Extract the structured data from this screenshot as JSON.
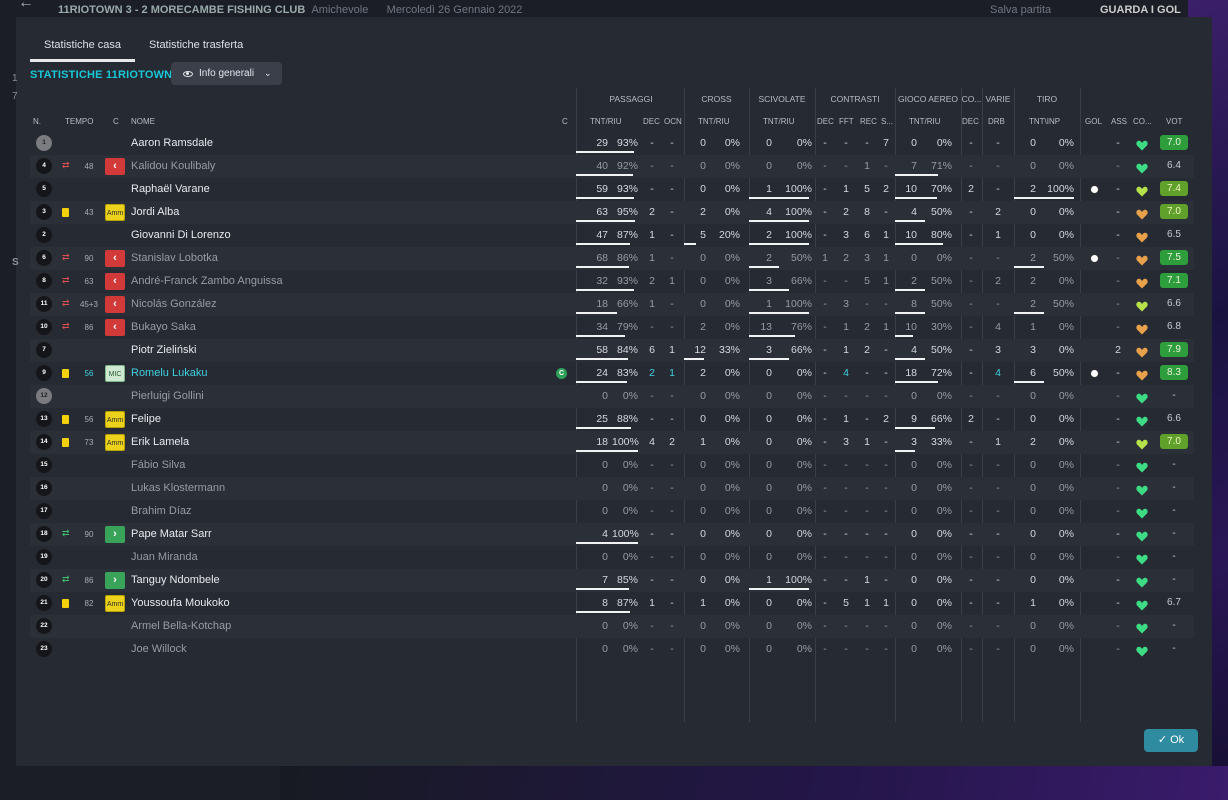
{
  "topbar": {
    "back": "←",
    "match": "11RIOTOWN 3 - 2 MORECAMBE FISHING CLUB",
    "type": "Amichevole",
    "date": "Mercoledì 26 Gennaio 2022",
    "save": "Salva partita",
    "goals": "GUARDA I GOL"
  },
  "tabs": [
    "Statistiche casa",
    "Statistiche trasferta"
  ],
  "team_title": "STATISTICHE 11RIOTOWN",
  "dropdown": "Info generali",
  "groups": {
    "passaggi": "PASSAGGI",
    "cross": "CROSS",
    "scivolate": "SCIVOLATE",
    "contrasti": "CONTRASTI",
    "aereo": "GIOCO AEREO",
    "co": "CO...",
    "varie": "VARIE",
    "tiro": "TIRO"
  },
  "headers": {
    "n": "N.",
    "tempo": "TEMPO",
    "c": "C",
    "nome": "NOME",
    "c2": "C",
    "p": "TNT/RIU",
    "dec": "DEC",
    "ocn": "OCN",
    "cr": "TNT/RIU",
    "sc": "TNT/RIU",
    "cdec": "DEC",
    "fft": "FFT",
    "rec": "REC",
    "s": "S...",
    "ga": "TNT/RIU",
    "codec": "DEC",
    "drb": "DRB",
    "tiro": "TNT\\INP",
    "gol": "GOL",
    "ass": "ASS",
    "co": "CO...",
    "vot": "VOT"
  },
  "colors": {
    "accent": "#18c8d8",
    "button": "#2e8ba0",
    "vote_good": "#2e9d3c"
  },
  "ok_label": "Ok",
  "players": [
    {
      "n": "1",
      "gk": true,
      "name": "Aaron Ramsdale",
      "dim": false,
      "p": [
        "29",
        "93%"
      ],
      "pb": 0.93,
      "pdec": "-",
      "ocn": "-",
      "cr": [
        "0",
        "0%"
      ],
      "crb": 0,
      "sc": [
        "0",
        "0%"
      ],
      "scb": 0,
      "cdec": "-",
      "fft": "-",
      "rec": "-",
      "s": "7",
      "ga": [
        "0",
        "0%"
      ],
      "gab": 0,
      "codec": "-",
      "drb": "-",
      "tiro": [
        "0",
        "0%"
      ],
      "tb": 0,
      "gol": "",
      "ass": "-",
      "heart": "green",
      "vot": "7.0",
      "votc": "good"
    },
    {
      "n": "4",
      "sub": "off",
      "min": "48",
      "cbox": "red",
      "name": "Kalidou Koulibaly",
      "dim": true,
      "p": [
        "40",
        "92%"
      ],
      "pb": 0.92,
      "pdec": "-",
      "ocn": "-",
      "cr": [
        "0",
        "0%"
      ],
      "crb": 0,
      "sc": [
        "0",
        "0%"
      ],
      "scb": 0,
      "cdec": "-",
      "fft": "-",
      "rec": "1",
      "s": "-",
      "ga": [
        "7",
        "71%"
      ],
      "gab": 0.71,
      "codec": "-",
      "drb": "-",
      "tiro": [
        "0",
        "0%"
      ],
      "tb": 0,
      "gol": "",
      "ass": "-",
      "heart": "green",
      "vot": "6.4",
      "votc": ""
    },
    {
      "n": "5",
      "name": "Raphaël Varane",
      "dim": false,
      "p": [
        "59",
        "93%"
      ],
      "pb": 0.93,
      "pdec": "-",
      "ocn": "-",
      "cr": [
        "0",
        "0%"
      ],
      "crb": 0,
      "sc": [
        "1",
        "100%"
      ],
      "scb": 1,
      "cdec": "-",
      "fft": "1",
      "rec": "5",
      "s": "2",
      "ga": [
        "10",
        "70%"
      ],
      "gab": 0.7,
      "codec": "2",
      "drb": "-",
      "tiro": [
        "2",
        "100%"
      ],
      "tb": 1,
      "gol": "ball",
      "ass": "-",
      "heart": "lime",
      "vot": "7.4",
      "votc": "ok"
    },
    {
      "n": "3",
      "yellow": true,
      "min": "43",
      "cbox": "amm",
      "name": "Jordi Alba",
      "dim": false,
      "p": [
        "63",
        "95%"
      ],
      "pb": 0.95,
      "pdec": "2",
      "ocn": "-",
      "cr": [
        "2",
        "0%"
      ],
      "crb": 0,
      "sc": [
        "4",
        "100%"
      ],
      "scb": 1,
      "cdec": "-",
      "fft": "2",
      "rec": "8",
      "s": "-",
      "ga": [
        "4",
        "50%"
      ],
      "gab": 0.5,
      "codec": "-",
      "drb": "2",
      "tiro": [
        "0",
        "0%"
      ],
      "tb": 0,
      "gol": "",
      "ass": "-",
      "heart": "orange",
      "vot": "7.0",
      "votc": "ok"
    },
    {
      "n": "2",
      "name": "Giovanni Di Lorenzo",
      "dim": false,
      "p": [
        "47",
        "87%"
      ],
      "pb": 0.87,
      "pdec": "1",
      "ocn": "-",
      "cr": [
        "5",
        "20%"
      ],
      "crb": 0.2,
      "sc": [
        "2",
        "100%"
      ],
      "scb": 1,
      "cdec": "-",
      "fft": "3",
      "rec": "6",
      "s": "1",
      "ga": [
        "10",
        "80%"
      ],
      "gab": 0.8,
      "codec": "-",
      "drb": "1",
      "tiro": [
        "0",
        "0%"
      ],
      "tb": 0,
      "gol": "",
      "ass": "-",
      "heart": "orange",
      "vot": "6.5",
      "votc": ""
    },
    {
      "n": "6",
      "sub": "off",
      "min": "90",
      "cbox": "red",
      "name": "Stanislav Lobotka",
      "dim": true,
      "p": [
        "68",
        "86%"
      ],
      "pb": 0.86,
      "pdec": "1",
      "ocn": "-",
      "cr": [
        "0",
        "0%"
      ],
      "crb": 0,
      "sc": [
        "2",
        "50%"
      ],
      "scb": 0.5,
      "cdec": "1",
      "fft": "2",
      "rec": "3",
      "s": "1",
      "ga": [
        "0",
        "0%"
      ],
      "gab": 0,
      "codec": "-",
      "drb": "-",
      "tiro": [
        "2",
        "50%"
      ],
      "tb": 0.5,
      "gol": "ball",
      "ass": "-",
      "heart": "orange",
      "vot": "7.5",
      "votc": "good"
    },
    {
      "n": "8",
      "sub": "off",
      "min": "63",
      "cbox": "red",
      "name": "André-Franck Zambo Anguissa",
      "dim": true,
      "p": [
        "32",
        "93%"
      ],
      "pb": 0.93,
      "pdec": "2",
      "ocn": "1",
      "cr": [
        "0",
        "0%"
      ],
      "crb": 0,
      "sc": [
        "3",
        "66%"
      ],
      "scb": 0.66,
      "cdec": "-",
      "fft": "-",
      "rec": "5",
      "s": "1",
      "ga": [
        "2",
        "50%"
      ],
      "gab": 0.5,
      "codec": "-",
      "drb": "2",
      "tiro": [
        "2",
        "0%"
      ],
      "tb": 0,
      "gol": "",
      "ass": "-",
      "heart": "orange",
      "vot": "7.1",
      "votc": "good"
    },
    {
      "n": "11",
      "sub": "off",
      "min": "45+3",
      "cbox": "red",
      "name": "Nicolás González",
      "dim": true,
      "p": [
        "18",
        "66%"
      ],
      "pb": 0.66,
      "pdec": "1",
      "ocn": "-",
      "cr": [
        "0",
        "0%"
      ],
      "crb": 0,
      "sc": [
        "1",
        "100%"
      ],
      "scb": 1,
      "cdec": "-",
      "fft": "3",
      "rec": "-",
      "s": "-",
      "ga": [
        "8",
        "50%"
      ],
      "gab": 0.5,
      "codec": "-",
      "drb": "-",
      "tiro": [
        "2",
        "50%"
      ],
      "tb": 0.5,
      "gol": "",
      "ass": "-",
      "heart": "lime",
      "vot": "6.6",
      "votc": ""
    },
    {
      "n": "10",
      "sub": "off",
      "min": "86",
      "cbox": "red",
      "name": "Bukayo Saka",
      "dim": true,
      "p": [
        "34",
        "79%"
      ],
      "pb": 0.79,
      "pdec": "-",
      "ocn": "-",
      "cr": [
        "2",
        "0%"
      ],
      "crb": 0,
      "sc": [
        "13",
        "76%"
      ],
      "scb": 0.76,
      "cdec": "-",
      "fft": "1",
      "rec": "2",
      "s": "1",
      "ga": [
        "10",
        "30%"
      ],
      "gab": 0.3,
      "codec": "-",
      "drb": "4",
      "tiro": [
        "1",
        "0%"
      ],
      "tb": 0,
      "gol": "",
      "ass": "-",
      "heart": "orange",
      "vot": "6.8",
      "votc": ""
    },
    {
      "n": "7",
      "name": "Piotr Zieliński",
      "dim": false,
      "p": [
        "58",
        "84%"
      ],
      "pb": 0.84,
      "pdec": "6",
      "ocn": "1",
      "cr": [
        "12",
        "33%"
      ],
      "crb": 0.33,
      "sc": [
        "3",
        "66%"
      ],
      "scb": 0.66,
      "cdec": "-",
      "fft": "1",
      "rec": "2",
      "s": "-",
      "ga": [
        "4",
        "50%"
      ],
      "gab": 0.5,
      "codec": "-",
      "drb": "3",
      "tiro": [
        "3",
        "0%"
      ],
      "tb": 0,
      "gol": "",
      "ass": "2",
      "heart": "orange",
      "vot": "7.9",
      "votc": "good"
    },
    {
      "n": "9",
      "yellow": true,
      "min": "56",
      "minc": "cyan",
      "cbox": "mic",
      "cboxtxt": "MIC",
      "name": "Romelu Lukaku",
      "dim": false,
      "cap": true,
      "p": [
        "24",
        "83%"
      ],
      "pb": 0.83,
      "pdec": "2",
      "ocn": "1",
      "cr": [
        "2",
        "0%"
      ],
      "crb": 0,
      "sc": [
        "0",
        "0%"
      ],
      "scb": 0,
      "cdec": "-",
      "fft": "4",
      "rec": "-",
      "s": "-",
      "ga": [
        "18",
        "72%"
      ],
      "gab": 0.72,
      "codec": "-",
      "drb": "4",
      "tiro": [
        "6",
        "50%"
      ],
      "tb": 0.5,
      "gol": "ball",
      "ass": "-",
      "heart": "orange",
      "vot": "8.3",
      "votc": "good",
      "cyan": true
    },
    {
      "n": "12",
      "gk": true,
      "name": "Pierluigi Gollini",
      "dim": true,
      "p": [
        "0",
        "0%"
      ],
      "pb": 0,
      "pdec": "-",
      "ocn": "-",
      "cr": [
        "0",
        "0%"
      ],
      "crb": 0,
      "sc": [
        "0",
        "0%"
      ],
      "scb": 0,
      "cdec": "-",
      "fft": "-",
      "rec": "-",
      "s": "-",
      "ga": [
        "0",
        "0%"
      ],
      "gab": 0,
      "codec": "-",
      "drb": "-",
      "tiro": [
        "0",
        "0%"
      ],
      "tb": 0,
      "gol": "",
      "ass": "-",
      "heart": "green",
      "vot": "-",
      "votc": ""
    },
    {
      "n": "13",
      "yellow": true,
      "min": "56",
      "cbox": "amm",
      "name": "Felipe",
      "dim": false,
      "p": [
        "25",
        "88%"
      ],
      "pb": 0.88,
      "pdec": "-",
      "ocn": "-",
      "cr": [
        "0",
        "0%"
      ],
      "crb": 0,
      "sc": [
        "0",
        "0%"
      ],
      "scb": 0,
      "cdec": "-",
      "fft": "1",
      "rec": "-",
      "s": "2",
      "ga": [
        "9",
        "66%"
      ],
      "gab": 0.66,
      "codec": "2",
      "drb": "-",
      "tiro": [
        "0",
        "0%"
      ],
      "tb": 0,
      "gol": "",
      "ass": "-",
      "heart": "green",
      "vot": "6.6",
      "votc": ""
    },
    {
      "n": "14",
      "yellow": true,
      "min": "73",
      "cbox": "amm",
      "name": "Erik Lamela",
      "dim": false,
      "p": [
        "18",
        "100%"
      ],
      "pb": 1,
      "pdec": "4",
      "ocn": "2",
      "cr": [
        "1",
        "0%"
      ],
      "crb": 0,
      "sc": [
        "0",
        "0%"
      ],
      "scb": 0,
      "cdec": "-",
      "fft": "3",
      "rec": "1",
      "s": "-",
      "ga": [
        "3",
        "33%"
      ],
      "gab": 0.33,
      "codec": "-",
      "drb": "1",
      "tiro": [
        "2",
        "0%"
      ],
      "tb": 0,
      "gol": "",
      "ass": "-",
      "heart": "lime",
      "vot": "7.0",
      "votc": "ok"
    },
    {
      "n": "15",
      "name": "Fábio Silva",
      "dim": true,
      "p": [
        "0",
        "0%"
      ],
      "pb": 0,
      "pdec": "-",
      "ocn": "-",
      "cr": [
        "0",
        "0%"
      ],
      "crb": 0,
      "sc": [
        "0",
        "0%"
      ],
      "scb": 0,
      "cdec": "-",
      "fft": "-",
      "rec": "-",
      "s": "-",
      "ga": [
        "0",
        "0%"
      ],
      "gab": 0,
      "codec": "-",
      "drb": "-",
      "tiro": [
        "0",
        "0%"
      ],
      "tb": 0,
      "gol": "",
      "ass": "-",
      "heart": "green",
      "vot": "-",
      "votc": ""
    },
    {
      "n": "16",
      "name": "Lukas Klostermann",
      "dim": true,
      "p": [
        "0",
        "0%"
      ],
      "pb": 0,
      "pdec": "-",
      "ocn": "-",
      "cr": [
        "0",
        "0%"
      ],
      "crb": 0,
      "sc": [
        "0",
        "0%"
      ],
      "scb": 0,
      "cdec": "-",
      "fft": "-",
      "rec": "-",
      "s": "-",
      "ga": [
        "0",
        "0%"
      ],
      "gab": 0,
      "codec": "-",
      "drb": "-",
      "tiro": [
        "0",
        "0%"
      ],
      "tb": 0,
      "gol": "",
      "ass": "-",
      "heart": "green",
      "vot": "-",
      "votc": ""
    },
    {
      "n": "17",
      "name": "Brahim Díaz",
      "dim": true,
      "p": [
        "0",
        "0%"
      ],
      "pb": 0,
      "pdec": "-",
      "ocn": "-",
      "cr": [
        "0",
        "0%"
      ],
      "crb": 0,
      "sc": [
        "0",
        "0%"
      ],
      "scb": 0,
      "cdec": "-",
      "fft": "-",
      "rec": "-",
      "s": "-",
      "ga": [
        "0",
        "0%"
      ],
      "gab": 0,
      "codec": "-",
      "drb": "-",
      "tiro": [
        "0",
        "0%"
      ],
      "tb": 0,
      "gol": "",
      "ass": "-",
      "heart": "green",
      "vot": "-",
      "votc": ""
    },
    {
      "n": "18",
      "sub": "on",
      "min": "90",
      "cbox": "green",
      "name": "Pape Matar Sarr",
      "dim": false,
      "p": [
        "4",
        "100%"
      ],
      "pb": 1,
      "pdec": "-",
      "ocn": "-",
      "cr": [
        "0",
        "0%"
      ],
      "crb": 0,
      "sc": [
        "0",
        "0%"
      ],
      "scb": 0,
      "cdec": "-",
      "fft": "-",
      "rec": "-",
      "s": "-",
      "ga": [
        "0",
        "0%"
      ],
      "gab": 0,
      "codec": "-",
      "drb": "-",
      "tiro": [
        "0",
        "0%"
      ],
      "tb": 0,
      "gol": "",
      "ass": "-",
      "heart": "green",
      "vot": "-",
      "votc": ""
    },
    {
      "n": "19",
      "name": "Juan Miranda",
      "dim": true,
      "p": [
        "0",
        "0%"
      ],
      "pb": 0,
      "pdec": "-",
      "ocn": "-",
      "cr": [
        "0",
        "0%"
      ],
      "crb": 0,
      "sc": [
        "0",
        "0%"
      ],
      "scb": 0,
      "cdec": "-",
      "fft": "-",
      "rec": "-",
      "s": "-",
      "ga": [
        "0",
        "0%"
      ],
      "gab": 0,
      "codec": "-",
      "drb": "-",
      "tiro": [
        "0",
        "0%"
      ],
      "tb": 0,
      "gol": "",
      "ass": "-",
      "heart": "green",
      "vot": "-",
      "votc": ""
    },
    {
      "n": "20",
      "sub": "on",
      "min": "86",
      "cbox": "green",
      "name": "Tanguy Ndombele",
      "dim": false,
      "p": [
        "7",
        "85%"
      ],
      "pb": 0.85,
      "pdec": "-",
      "ocn": "-",
      "cr": [
        "0",
        "0%"
      ],
      "crb": 0,
      "sc": [
        "1",
        "100%"
      ],
      "scb": 1,
      "cdec": "-",
      "fft": "-",
      "rec": "1",
      "s": "-",
      "ga": [
        "0",
        "0%"
      ],
      "gab": 0,
      "codec": "-",
      "drb": "-",
      "tiro": [
        "0",
        "0%"
      ],
      "tb": 0,
      "gol": "",
      "ass": "-",
      "heart": "green",
      "vot": "-",
      "votc": ""
    },
    {
      "n": "21",
      "yellow": true,
      "min": "82",
      "cbox": "amm",
      "name": "Youssoufa Moukoko",
      "dim": false,
      "p": [
        "8",
        "87%"
      ],
      "pb": 0.87,
      "pdec": "1",
      "ocn": "-",
      "cr": [
        "1",
        "0%"
      ],
      "crb": 0,
      "sc": [
        "0",
        "0%"
      ],
      "scb": 0,
      "cdec": "-",
      "fft": "5",
      "rec": "1",
      "s": "1",
      "ga": [
        "0",
        "0%"
      ],
      "gab": 0,
      "codec": "-",
      "drb": "-",
      "tiro": [
        "1",
        "0%"
      ],
      "tb": 0,
      "gol": "",
      "ass": "-",
      "heart": "green",
      "vot": "6.7",
      "votc": ""
    },
    {
      "n": "22",
      "name": "Armel Bella-Kotchap",
      "dim": true,
      "p": [
        "0",
        "0%"
      ],
      "pb": 0,
      "pdec": "-",
      "ocn": "-",
      "cr": [
        "0",
        "0%"
      ],
      "crb": 0,
      "sc": [
        "0",
        "0%"
      ],
      "scb": 0,
      "cdec": "-",
      "fft": "-",
      "rec": "-",
      "s": "-",
      "ga": [
        "0",
        "0%"
      ],
      "gab": 0,
      "codec": "-",
      "drb": "-",
      "tiro": [
        "0",
        "0%"
      ],
      "tb": 0,
      "gol": "",
      "ass": "-",
      "heart": "green",
      "vot": "-",
      "votc": ""
    },
    {
      "n": "23",
      "name": "Joe Willock",
      "dim": true,
      "p": [
        "0",
        "0%"
      ],
      "pb": 0,
      "pdec": "-",
      "ocn": "-",
      "cr": [
        "0",
        "0%"
      ],
      "crb": 0,
      "sc": [
        "0",
        "0%"
      ],
      "scb": 0,
      "cdec": "-",
      "fft": "-",
      "rec": "-",
      "s": "-",
      "ga": [
        "0",
        "0%"
      ],
      "gab": 0,
      "codec": "-",
      "drb": "-",
      "tiro": [
        "0",
        "0%"
      ],
      "tb": 0,
      "gol": "",
      "ass": "-",
      "heart": "green",
      "vot": "-",
      "votc": ""
    }
  ]
}
